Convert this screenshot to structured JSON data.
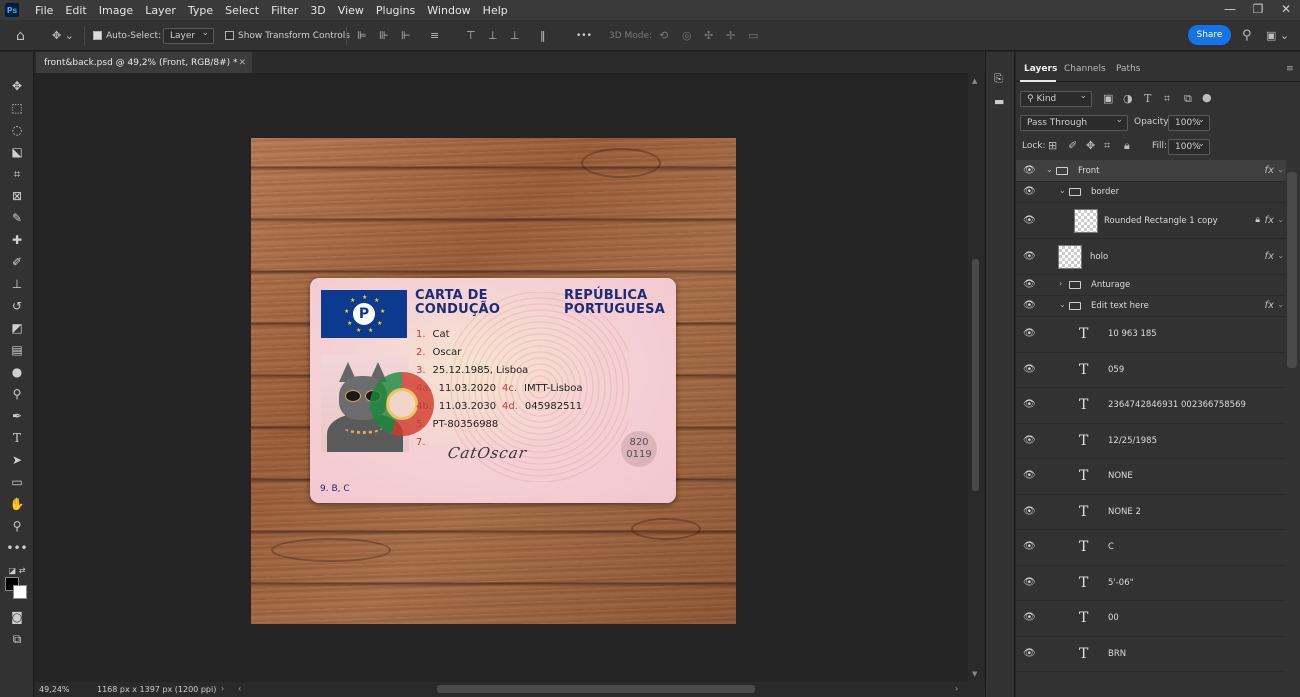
{
  "app": {
    "logo_text": "Ps"
  },
  "menu": [
    "File",
    "Edit",
    "Image",
    "Layer",
    "Type",
    "Select",
    "Filter",
    "3D",
    "View",
    "Plugins",
    "Window",
    "Help"
  ],
  "window_controls": {
    "minimize": "—",
    "restore": "❐",
    "close": "✕"
  },
  "options_bar": {
    "auto_select_label": "Auto-Select:",
    "auto_select_checked": true,
    "auto_select_target": "Layer",
    "show_transform_label": "Show Transform Controls",
    "show_transform_checked": false,
    "more": "•••",
    "mode_3d_label": "3D Mode:",
    "share_label": "Share"
  },
  "document": {
    "tab_title": "front&back.psd @ 49,2% (Front, RGB/8#) *",
    "zoom": "49,24%",
    "dimensions": "1168 px x 1397 px (1200 ppi)"
  },
  "card": {
    "p_badge": "P",
    "title_left_1": "CARTA DE",
    "title_left_2": "CONDUÇÃO",
    "title_right_1": "REPÚBLICA",
    "title_right_2": "PORTUGUESA",
    "fields": [
      {
        "num": "1.",
        "value": "Cat"
      },
      {
        "num": "2.",
        "value": "Oscar"
      },
      {
        "num": "3.",
        "value": "25.12.1985, Lisboa"
      },
      {
        "num": "4a.",
        "value": "11.03.2020"
      },
      {
        "num": "4b.",
        "value": "11.03.2030"
      },
      {
        "num": "5.",
        "value": "PT-80356988"
      },
      {
        "num": "7.",
        "value": ""
      }
    ],
    "field_4c": {
      "num": "4c.",
      "value": "IMTT-Lisboa"
    },
    "field_4d": {
      "num": "4d.",
      "value": "045982511"
    },
    "signature": "CatOscar",
    "stamp_line1": "820",
    "stamp_line2": "0119",
    "categories": "9. B, C"
  },
  "panel": {
    "tabs": [
      "Layers",
      "Channels",
      "Paths"
    ],
    "active_tab": "Layers",
    "filter_kind": "Kind",
    "blend_mode": "Pass Through",
    "opacity_label": "Opacity:",
    "opacity_value": "100%",
    "lock_label": "Lock:",
    "fill_label": "Fill:",
    "fill_value": "100%",
    "layers": [
      {
        "name": "Front",
        "type": "group",
        "indent": 0,
        "expanded": true,
        "fx": true,
        "selected": true
      },
      {
        "name": "border",
        "type": "group",
        "indent": 1,
        "expanded": true,
        "fx": false
      },
      {
        "name": "Rounded Rectangle 1 copy",
        "type": "shape",
        "indent": 2,
        "fx": true,
        "locked": true
      },
      {
        "name": "holo",
        "type": "pixel",
        "indent": 1,
        "fx": true
      },
      {
        "name": "Anturage",
        "type": "group",
        "indent": 1,
        "expanded": false,
        "fx": false
      },
      {
        "name": "Edit text here",
        "type": "group",
        "indent": 1,
        "expanded": true,
        "fx": true
      },
      {
        "name": "10 963 185",
        "type": "text"
      },
      {
        "name": "059",
        "type": "text"
      },
      {
        "name": "2364742846931 002366758569",
        "type": "text"
      },
      {
        "name": "12/25/1985",
        "type": "text"
      },
      {
        "name": "NONE",
        "type": "text"
      },
      {
        "name": "NONE 2",
        "type": "text"
      },
      {
        "name": "C",
        "type": "text"
      },
      {
        "name": "5'-06\"",
        "type": "text"
      },
      {
        "name": "00",
        "type": "text"
      },
      {
        "name": "BRN",
        "type": "text"
      }
    ]
  },
  "colors": {
    "accent": "#1473e6",
    "card_title": "#1c2b7a",
    "eu_blue": "#0b3a8f"
  }
}
